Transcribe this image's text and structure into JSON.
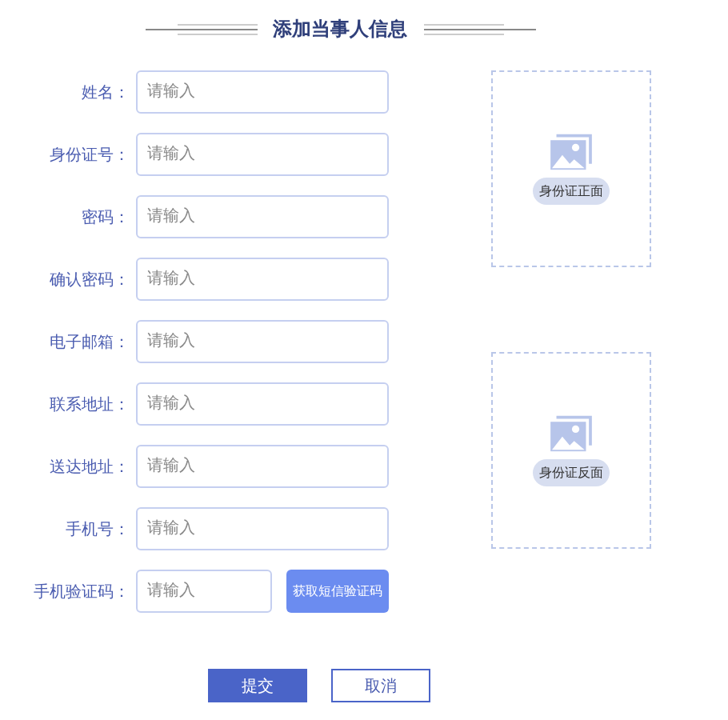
{
  "title": "添加当事人信息",
  "fields": [
    {
      "label": "姓名：",
      "placeholder": "请输入"
    },
    {
      "label": "身份证号：",
      "placeholder": "请输入"
    },
    {
      "label": "密码：",
      "placeholder": "请输入"
    },
    {
      "label": "确认密码：",
      "placeholder": "请输入"
    },
    {
      "label": "电子邮箱：",
      "placeholder": "请输入"
    },
    {
      "label": "联系地址：",
      "placeholder": "请输入"
    },
    {
      "label": "送达地址：",
      "placeholder": "请输入"
    },
    {
      "label": "手机号：",
      "placeholder": "请输入"
    },
    {
      "label": "手机验证码：",
      "placeholder": "请输入",
      "button": "获取短信验证码"
    }
  ],
  "uploads": [
    {
      "label": "身份证正面"
    },
    {
      "label": "身份证反面"
    }
  ],
  "buttons": [
    {
      "label": "提交",
      "kind": "primary"
    },
    {
      "label": "取消",
      "kind": "secondary"
    }
  ]
}
